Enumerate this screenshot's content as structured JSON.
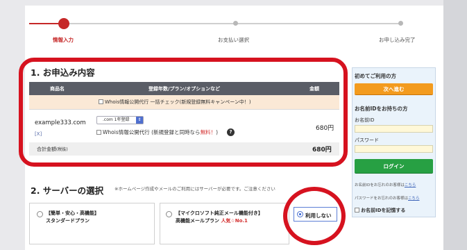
{
  "steps": [
    {
      "label": "情報入力"
    },
    {
      "label": "お支払い選択"
    },
    {
      "label": "お申し込み完了"
    }
  ],
  "section1": {
    "title": "1. お申込み内容",
    "headers": [
      "商品名",
      "登録年数/プラン/オプションなど",
      "金額"
    ],
    "whois_bulk": "Whois情報公開代行 一括チェック(新規登録無料キャンペーン中！)",
    "domain": "example333.com",
    "remove_mark": "[X]",
    "plan_select": ".com 1年登録",
    "whois_option": "Whois情報公開代行 (新規登録と同時なら",
    "whois_free": "無料！",
    "whois_close": ")",
    "help_symbol": "?",
    "price": "680円",
    "total_label": "合計金額",
    "total_tax": "(税抜)",
    "total_price": "680円"
  },
  "section2": {
    "title": "2. サーバーの選択",
    "note": "※ホームページ作成やメールのご利用にはサーバーが必要です。ご注意ください",
    "cards": [
      {
        "line1": "【簡単・安心・高機能】",
        "line2": "スタンダードプラン"
      },
      {
        "line1": "【マイクロソフト純正メール機能付き】",
        "line2": "高機能メールプラン",
        "popular": "人気☆No.1"
      }
    ],
    "no_use": "利用しない"
  },
  "sidebar": {
    "first_time": "初めてご利用の方",
    "next_button": "次へ進む",
    "have_id": "お名前IDをお持ちの方",
    "id_label": "お名前ID",
    "password_label": "パスワード",
    "login_button": "ログイン",
    "forgot_id": "お名前IDをお忘れのお客様は",
    "forgot_pw": "パスワードをお忘れのお客様は",
    "here": "こちら",
    "remember": "お名前IDを記憶する"
  },
  "colors": {
    "accent_red": "#c62828",
    "highlight_red": "#d6121f",
    "orange_button": "#f39b1e",
    "green_button": "#27a043"
  }
}
